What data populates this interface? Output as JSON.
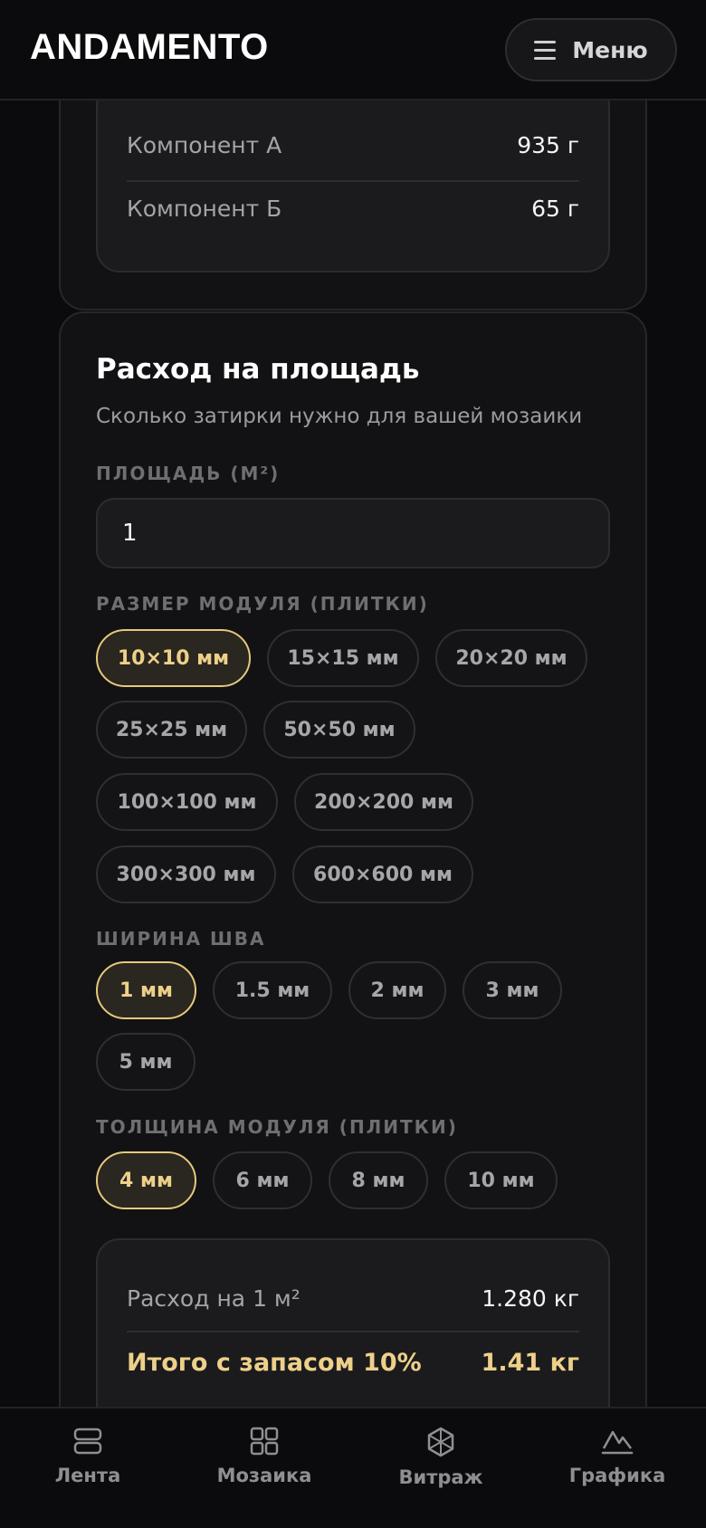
{
  "header": {
    "logo": "ANDAMENTO",
    "menu_label": "Меню"
  },
  "components": {
    "rows": [
      {
        "label": "Компонент А",
        "value": "935 г"
      },
      {
        "label": "Компонент Б",
        "value": "65 г"
      }
    ]
  },
  "calculator": {
    "title": "Расход на площадь",
    "subtitle": "Сколько затирки нужно для вашей мозаики",
    "area_label": "ПЛОЩАДЬ (М²)",
    "area_value": "1",
    "module_size_label": "РАЗМЕР МОДУЛЯ (ПЛИТКИ)",
    "module_sizes": [
      "10×10 мм",
      "15×15 мм",
      "20×20 мм",
      "25×25 мм",
      "50×50 мм",
      "100×100 мм",
      "200×200 мм",
      "300×300 мм",
      "600×600 мм"
    ],
    "module_size_selected": "10×10 мм",
    "joint_width_label": "ШИРИНА ШВА",
    "joint_widths": [
      "1 мм",
      "1.5 мм",
      "2 мм",
      "3 мм",
      "5 мм"
    ],
    "joint_width_selected": "1 мм",
    "thickness_label": "ТОЛЩИНА МОДУЛЯ (ПЛИТКИ)",
    "thicknesses": [
      "4 мм",
      "6 мм",
      "8 мм",
      "10 мм"
    ],
    "thickness_selected": "4 мм",
    "result": {
      "per_m2_label": "Расход на 1 м²",
      "per_m2_value": "1.280 кг",
      "total_label": "Итого с запасом 10%",
      "total_value": "1.41 кг"
    }
  },
  "accent_color": "#edd089",
  "bottom_nav": {
    "items": [
      {
        "label": "Лента",
        "icon": "feed-icon"
      },
      {
        "label": "Мозаика",
        "icon": "grid-icon"
      },
      {
        "label": "Витраж",
        "icon": "stained-glass-icon"
      },
      {
        "label": "Графика",
        "icon": "mountain-icon"
      }
    ]
  }
}
